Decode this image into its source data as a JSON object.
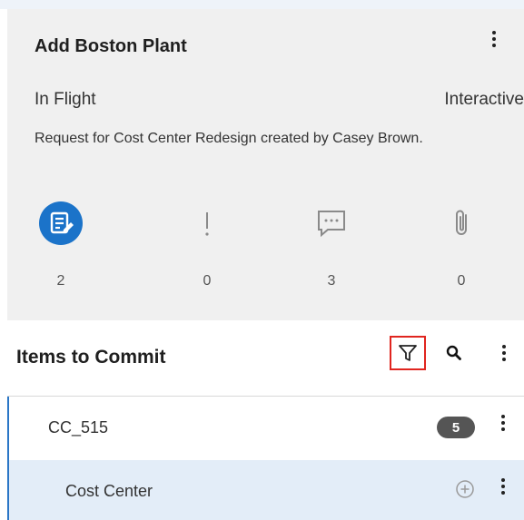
{
  "card": {
    "title": "Add Boston Plant",
    "status": "In Flight",
    "mode": "Interactive",
    "description": "Request for Cost Center Redesign created by Casey Brown.",
    "stats": [
      {
        "icon": "request-edit-icon",
        "count": "2"
      },
      {
        "icon": "exclamation-icon",
        "count": "0"
      },
      {
        "icon": "comment-icon",
        "count": "3"
      },
      {
        "icon": "paperclip-icon",
        "count": "0"
      }
    ]
  },
  "items_section": {
    "title": "Items to Commit",
    "rows": [
      {
        "label": "CC_515",
        "badge": "5"
      },
      {
        "label": "Cost Center"
      }
    ]
  },
  "colors": {
    "accent": "#1b73c9",
    "highlight_border": "#e0251f",
    "selected_row": "#e3edf8",
    "badge": "#555555"
  }
}
